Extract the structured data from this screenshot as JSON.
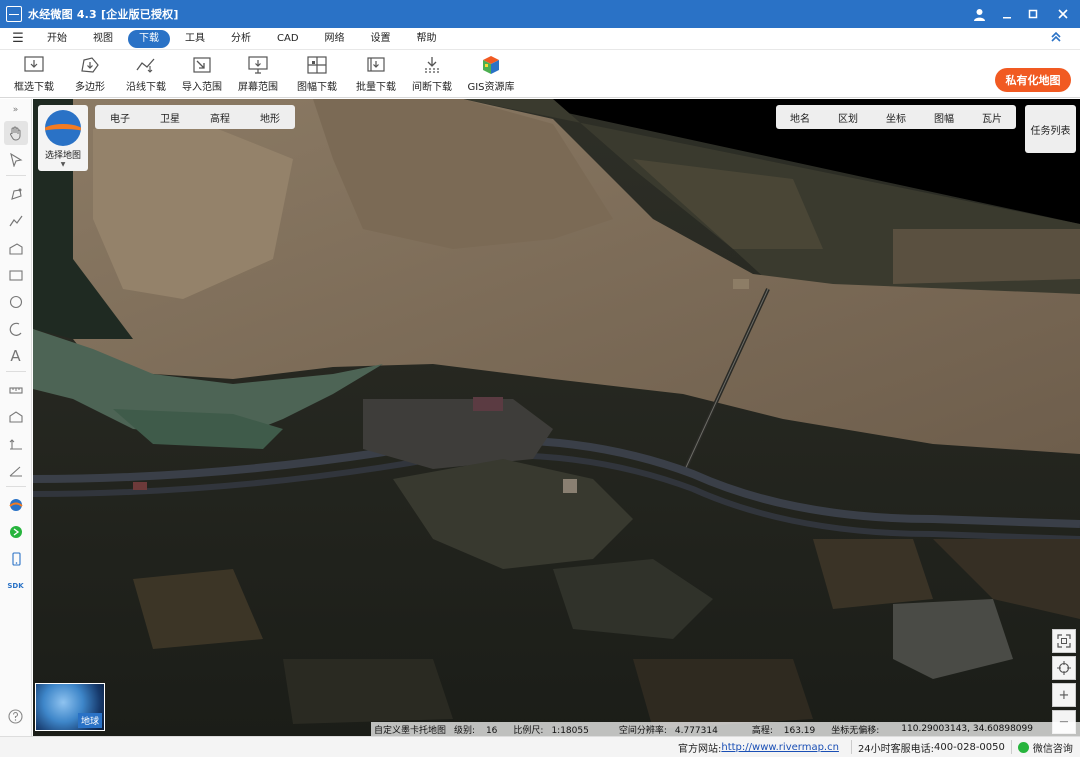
{
  "window": {
    "title": "水经微图 4.3 [企业版已授权]"
  },
  "menu": {
    "items": [
      {
        "label": "开始"
      },
      {
        "label": "视图"
      },
      {
        "label": "下载",
        "active": true
      },
      {
        "label": "工具"
      },
      {
        "label": "分析"
      },
      {
        "label": "CAD"
      },
      {
        "label": "网络"
      },
      {
        "label": "设置"
      },
      {
        "label": "帮助"
      }
    ]
  },
  "toolbar": {
    "tools": [
      {
        "label": "框选下载",
        "icon": "box-download-icon"
      },
      {
        "label": "多边形",
        "icon": "polygon-icon"
      },
      {
        "label": "沿线下载",
        "icon": "line-download-icon"
      },
      {
        "label": "导入范围",
        "icon": "import-range-icon"
      },
      {
        "label": "屏幕范围",
        "icon": "screen-range-icon"
      },
      {
        "label": "图幅下载",
        "icon": "sheet-download-icon"
      },
      {
        "label": "批量下载",
        "icon": "batch-download-icon"
      },
      {
        "label": "间断下载",
        "icon": "resume-download-icon"
      },
      {
        "label": "GIS资源库",
        "icon": "gis-library-icon"
      }
    ],
    "private_map": "私有化地图"
  },
  "map": {
    "select_label": "选择地图",
    "map_types": [
      "电子",
      "卫星",
      "高程",
      "地形"
    ],
    "layers": [
      "地名",
      "区划",
      "坐标",
      "图幅",
      "瓦片"
    ],
    "task_list": "任务列表",
    "globe_label": "地球",
    "status": {
      "source": "自定义墨卡托地图",
      "level_label": "级别:",
      "level": "16",
      "scale_label": "比例尺:",
      "scale": "1:18055",
      "resolution_label": "空间分辨率:",
      "resolution": "4.777314",
      "elevation_label": "高程:",
      "elevation": "163.19",
      "offset_label": "坐标无偏移:",
      "coords": "110.29003143, 34.60898099"
    }
  },
  "statusbar": {
    "site_label": "官方网站:",
    "site_url": "http://www.rivermap.cn",
    "phone_label": "24小时客服电话:",
    "phone": "400-028-0050",
    "wechat": "微信咨询"
  }
}
